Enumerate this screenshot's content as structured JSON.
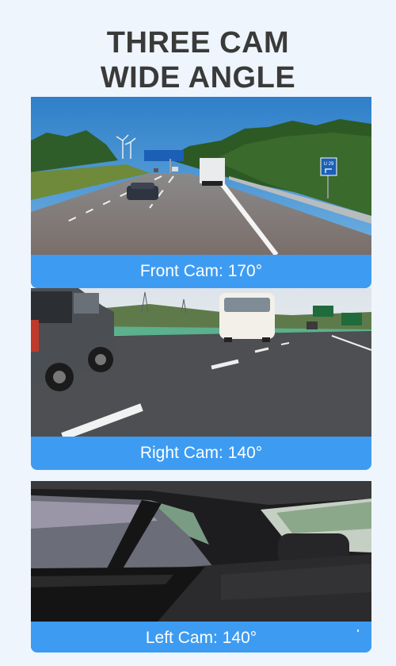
{
  "title": {
    "line1": "THREE CAM",
    "line2": "WIDE ANGLE"
  },
  "panels": [
    {
      "caption": "Front Cam: 170°",
      "scene": "highway-front-view",
      "sign_text": "U 29"
    },
    {
      "caption": "Right Cam: 140°",
      "scene": "highway-side-view"
    },
    {
      "caption": "Left Cam: 140°",
      "scene": "car-interior-rear-seat"
    }
  ],
  "colors": {
    "background": "#eef5fc",
    "caption_bar": "#3d9cf2",
    "title_text": "#3a3a3a"
  }
}
